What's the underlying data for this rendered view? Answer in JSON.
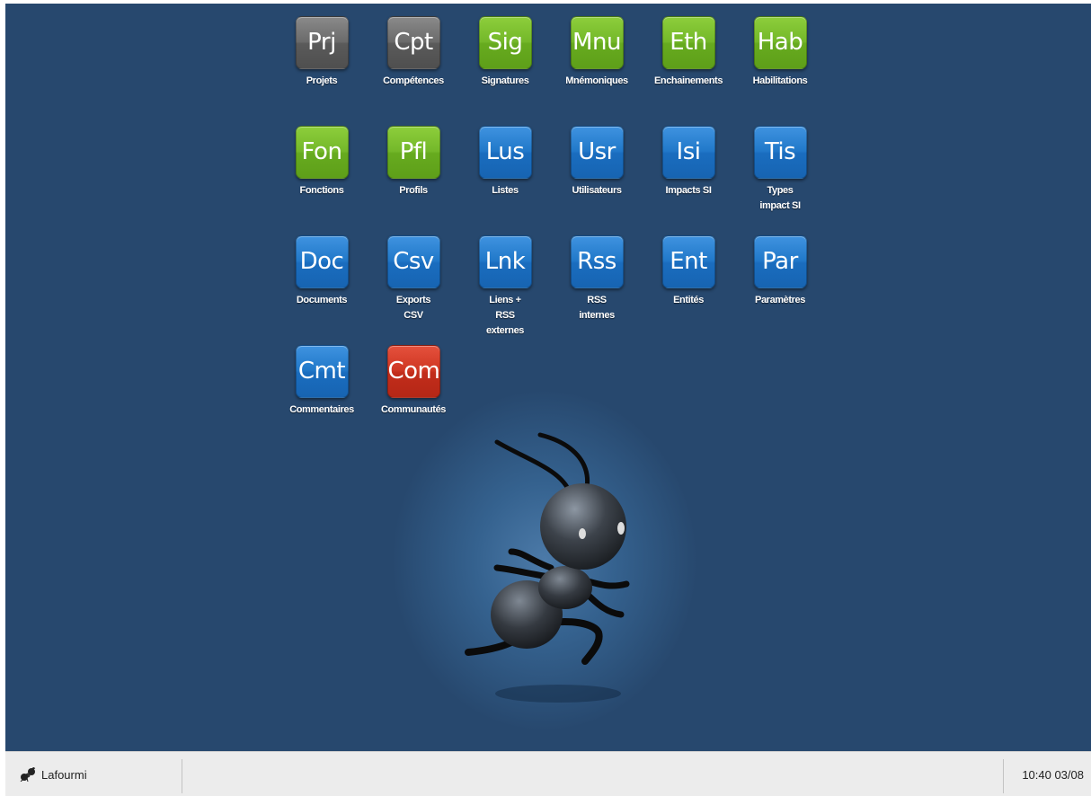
{
  "desktop": {
    "icons": [
      {
        "code": "Prj",
        "label": "Projets",
        "color": "gray"
      },
      {
        "code": "Cpt",
        "label": "Compétences",
        "color": "gray"
      },
      {
        "code": "Sig",
        "label": "Signatures",
        "color": "green"
      },
      {
        "code": "Mnu",
        "label": "Mnémoniques",
        "color": "green"
      },
      {
        "code": "Eth",
        "label": "Enchainements",
        "color": "green"
      },
      {
        "code": "Hab",
        "label": "Habilitations",
        "color": "green"
      },
      {
        "code": "Fon",
        "label": "Fonctions",
        "color": "green"
      },
      {
        "code": "Pfl",
        "label": "Profils",
        "color": "green"
      },
      {
        "code": "Lus",
        "label": "Listes",
        "color": "blue"
      },
      {
        "code": "Usr",
        "label": "Utilisateurs",
        "color": "blue"
      },
      {
        "code": "Isi",
        "label": "Impacts SI",
        "color": "blue"
      },
      {
        "code": "Tis",
        "label": "Types\nimpact SI",
        "color": "blue"
      },
      {
        "code": "Doc",
        "label": "Documents",
        "color": "blue"
      },
      {
        "code": "Csv",
        "label": "Exports\nCSV",
        "color": "blue"
      },
      {
        "code": "Lnk",
        "label": "Liens +\nRSS\nexternes",
        "color": "blue"
      },
      {
        "code": "Rss",
        "label": "RSS\ninternes",
        "color": "blue"
      },
      {
        "code": "Ent",
        "label": "Entités",
        "color": "blue"
      },
      {
        "code": "Par",
        "label": "Paramètres",
        "color": "blue"
      },
      {
        "code": "Cmt",
        "label": "Commentaires",
        "color": "blue"
      },
      {
        "code": "Com",
        "label": "Communautés",
        "color": "red"
      }
    ],
    "mascot_icon": "ant-mascot"
  },
  "taskbar": {
    "start_label": "Lafourmi",
    "start_icon": "ant-icon",
    "clock": "10:40 03/08"
  }
}
